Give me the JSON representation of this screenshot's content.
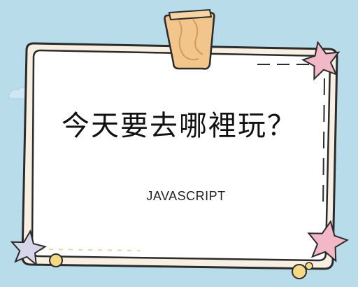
{
  "card": {
    "title": "今天要去哪裡玩？",
    "subtitle": "JAVASCRIPT"
  },
  "colors": {
    "background": "#b9dcea",
    "card_fill": "#ffffff",
    "card_outline": "#2b2b2b",
    "card_inner_border": "#f3e4c9",
    "tape": "#f1c58c",
    "star_pink": "#f2b8c8",
    "star_lilac": "#d7d5ea",
    "dot_yellow": "#f5d987",
    "cloud": "#cfe6f1"
  },
  "icons": [
    "washi-tape-icon",
    "star-icon",
    "cloud-icon",
    "dot-icon"
  ]
}
